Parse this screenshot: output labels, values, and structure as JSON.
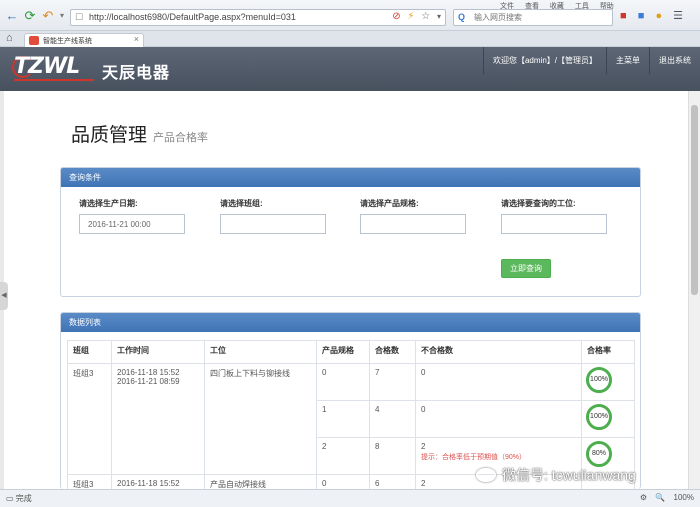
{
  "browser": {
    "back_icon": "back-arrow-icon",
    "forward_icon": "refresh-icon",
    "url": "http://localhost6980/DefaultPage.aspx?menuId=031",
    "search_placeholder": "输入网页搜索",
    "menu": [
      "文件",
      "查看",
      "收藏",
      "工具",
      "帮助"
    ],
    "tab_title": "智能生产线系统"
  },
  "header": {
    "logo_text": "TZWL",
    "brand_name": "天辰电器",
    "user_label": "欢迎您【admin】/【管理员】",
    "main_menu": "主菜单",
    "logout": "退出系统"
  },
  "page": {
    "title": "品质管理",
    "subtitle": "产品合格率"
  },
  "query": {
    "panel_title": "查询条件",
    "date_label": "请选择生产日期:",
    "date_value": "2016-11-21 00:00",
    "team_label": "请选择班组:",
    "team_value": "",
    "spec_label": "请选择产品规格:",
    "spec_value": "",
    "station_label": "请选择要查询的工位:",
    "station_value": "",
    "button": "立即查询"
  },
  "data_list": {
    "panel_title": "数据列表",
    "columns": [
      "班组",
      "工作时间",
      "工位",
      "产品规格",
      "合格数",
      "不合格数",
      "合格率"
    ],
    "rows": [
      {
        "team": "班组3",
        "time1": "2016-11-18 15:52",
        "time2": "2016-11-21 08:59",
        "station": "四门板上下料与铆接线",
        "spec": "0",
        "pass": "7",
        "fail": "0",
        "rate": "100%",
        "hint": ""
      },
      {
        "team": "",
        "time1": "",
        "time2": "",
        "station": "",
        "spec": "1",
        "pass": "4",
        "fail": "0",
        "rate": "100%",
        "hint": ""
      },
      {
        "team": "",
        "time1": "",
        "time2": "",
        "station": "",
        "spec": "2",
        "pass": "8",
        "fail": "2",
        "rate": "80%",
        "hint": "提示：合格率低于预期值（90%）"
      },
      {
        "team": "班组3",
        "time1": "2016-11-18 15:52",
        "time2": "",
        "station": "产品自动焊接线",
        "spec": "0",
        "pass": "6",
        "fail": "2",
        "rate": "",
        "hint": ""
      }
    ]
  },
  "status": {
    "left": "完成",
    "zoom": "100%"
  },
  "watermark": "微信号: tcwulianwang",
  "colors": {
    "header_bg": "#48515e",
    "panel_head": "#3f74b5",
    "query_button": "#5cb85c",
    "ring": "#4cae4c",
    "hint": "#d9534f"
  }
}
